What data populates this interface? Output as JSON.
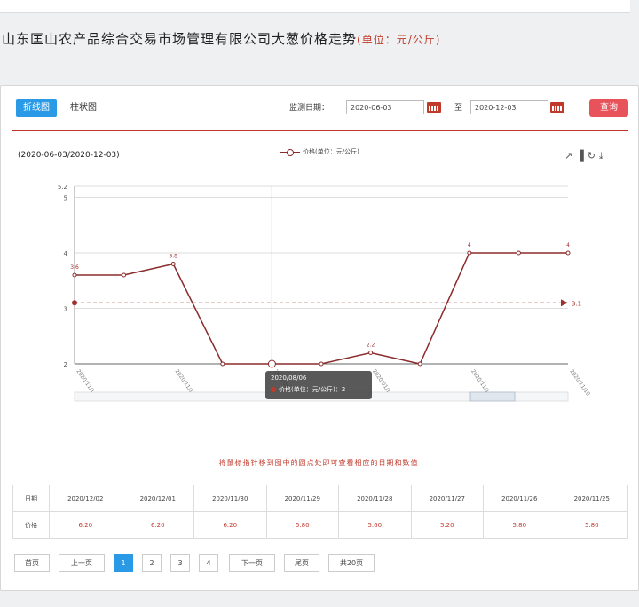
{
  "page": {
    "title": "山东匡山农产品综合交易市场管理有限公司大葱价格走势",
    "unit": "(单位：元/公斤)"
  },
  "toolbar": {
    "tab_line": "折线图",
    "tab_bar": "柱状图",
    "date_label": "监测日期：",
    "start_date": "2020-06-03",
    "to_label": "至",
    "end_date": "2020-12-03",
    "query_label": "查询"
  },
  "chart_header": {
    "range": "(2020-06-03/2020-12-03)",
    "legend": "价格(单位：元/公斤)",
    "tools": [
      "line-chart-icon",
      "bar-chart-icon",
      "refresh-icon",
      "download-icon"
    ]
  },
  "chart_data": {
    "type": "line",
    "series": [
      {
        "name": "价格(单位：元/公斤)",
        "values": [
          3.6,
          3.6,
          3.8,
          2,
          2,
          2,
          2.2,
          2,
          4,
          4,
          4
        ]
      }
    ],
    "ylim": [
      2,
      5.2
    ],
    "yticks": [
      "2",
      "3",
      "4",
      "5",
      "5.2"
    ],
    "xticks": [
      "2020/11/18",
      "2020/11/15",
      "2020/08/06",
      "2020/01/18",
      "2020/11/18",
      "2020/11/10"
    ],
    "point_labels": [
      "3.6",
      "3.8",
      "2.2",
      "4",
      "4"
    ],
    "average": 3.1,
    "average_label": "3.1",
    "tooltip": {
      "date": "2020/08/06",
      "label": "价格(单位：元/公斤)：2"
    },
    "line_color": "#8b2b2b"
  },
  "hint": "将鼠标指针移到图中的圆点处即可查看相应的日期和数值",
  "table": {
    "date_header": "日期",
    "price_header": "价格",
    "dates": [
      "2020/12/02",
      "2020/12/01",
      "2020/11/30",
      "2020/11/29",
      "2020/11/28",
      "2020/11/27",
      "2020/11/26",
      "2020/11/25"
    ],
    "prices": [
      "6.20",
      "6.20",
      "6.20",
      "5.80",
      "5.60",
      "5.20",
      "5.80",
      "5.80"
    ]
  },
  "pagination": {
    "first": "首页",
    "prev": "上一页",
    "pages": [
      "1",
      "2",
      "3",
      "4"
    ],
    "next": "下一页",
    "last": "尾页",
    "total": "共20页"
  },
  "colors": {
    "accent": "#2b9ae6",
    "query": "#e8535b",
    "line": "#8b2b2b",
    "hint": "#c0392b"
  }
}
